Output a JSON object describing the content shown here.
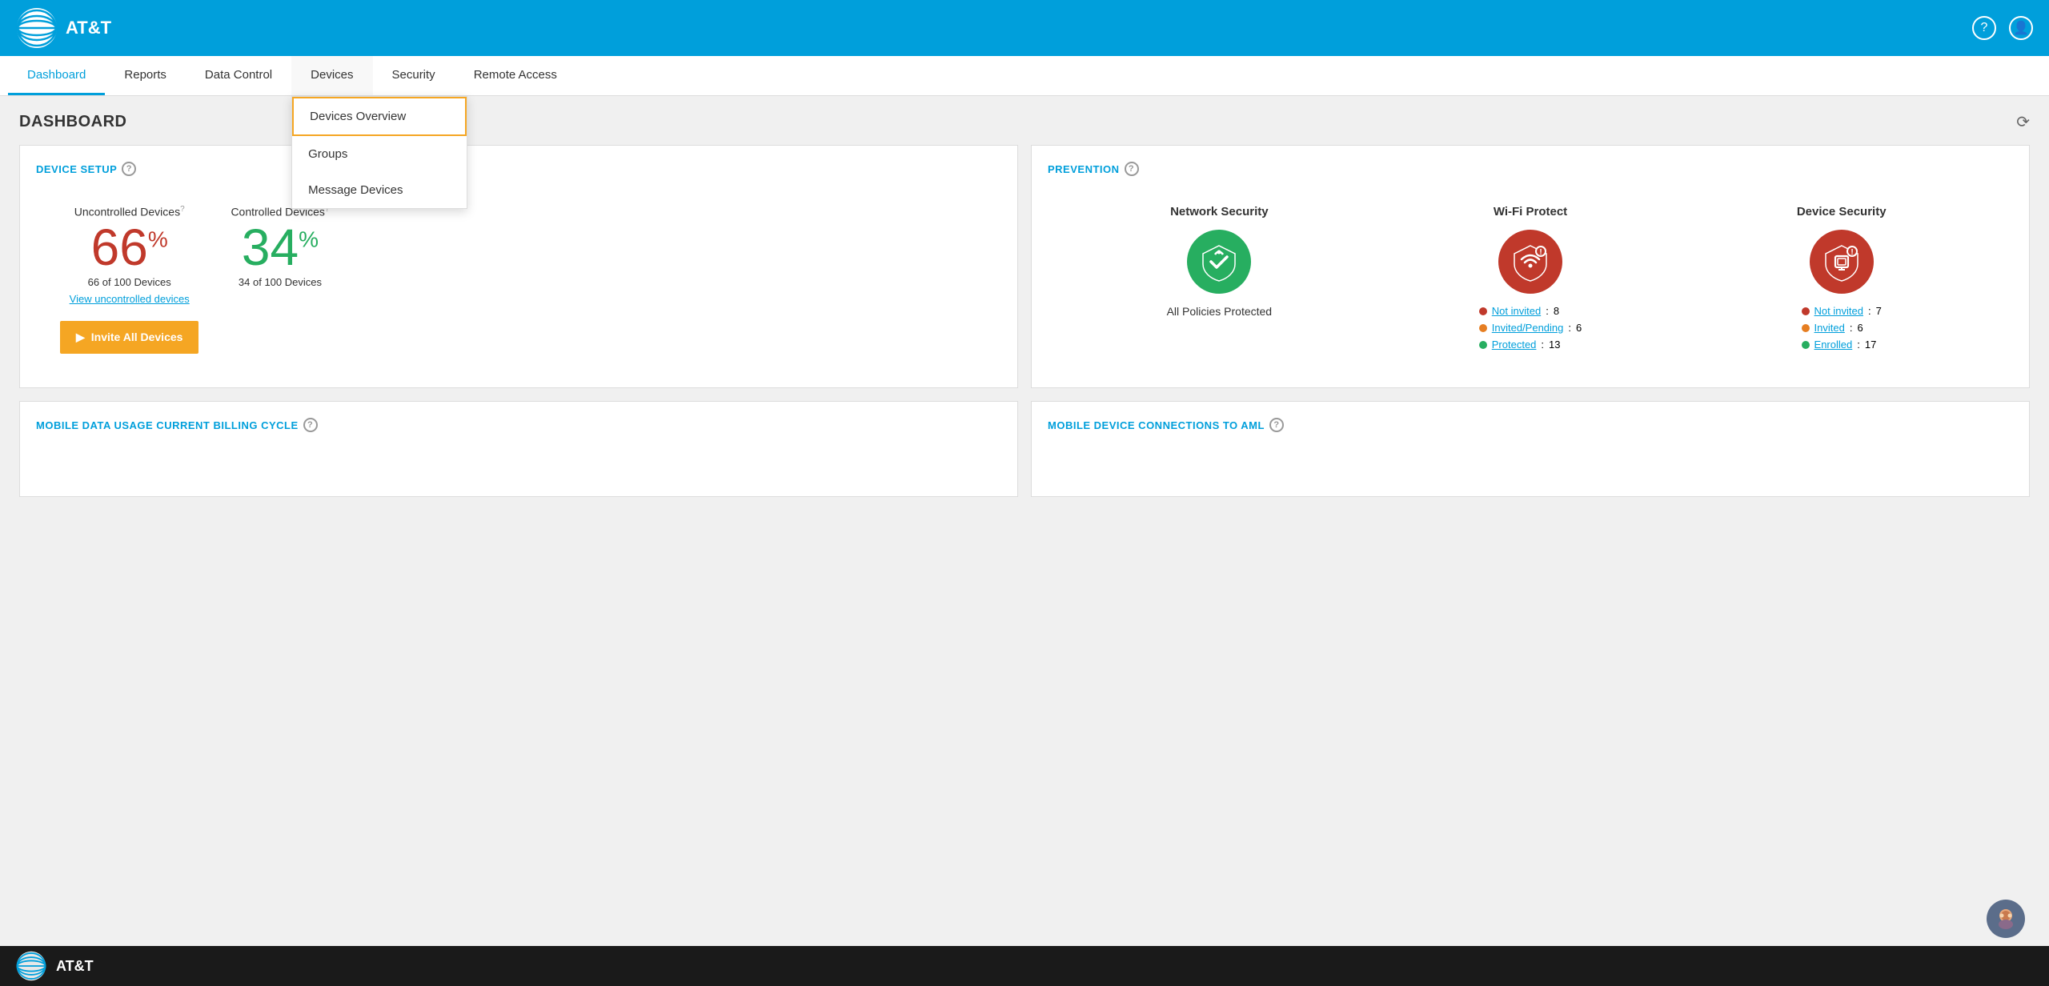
{
  "header": {
    "logo_text": "AT&T",
    "help_icon": "?",
    "user_icon": "👤"
  },
  "nav": {
    "items": [
      {
        "id": "dashboard",
        "label": "Dashboard",
        "active": true
      },
      {
        "id": "reports",
        "label": "Reports",
        "active": false
      },
      {
        "id": "data-control",
        "label": "Data Control",
        "active": false
      },
      {
        "id": "devices",
        "label": "Devices",
        "active": false
      },
      {
        "id": "security",
        "label": "Security",
        "active": false
      },
      {
        "id": "remote-access",
        "label": "Remote Access",
        "active": false
      }
    ],
    "devices_dropdown": {
      "items": [
        {
          "id": "devices-overview",
          "label": "Devices Overview",
          "highlighted": true
        },
        {
          "id": "groups",
          "label": "Groups"
        },
        {
          "id": "message-devices",
          "label": "Message Devices"
        }
      ]
    }
  },
  "dashboard": {
    "title": "DASHBOARD",
    "refresh_title": "Refresh"
  },
  "device_setup": {
    "title": "DEVICE SETUP",
    "help": "?",
    "uncontrolled_label": "Uncontrolled Devices",
    "uncontrolled_percent": "66",
    "uncontrolled_count": "66 of 100 Devices",
    "view_link": "View uncontrolled devices",
    "controlled_label": "Controlled Devices",
    "controlled_percent": "34",
    "controlled_count": "34 of 100 Devices",
    "invite_button": "Invite All Devices"
  },
  "prevention": {
    "title": "PREVENTION",
    "help": "?",
    "network_security": {
      "title": "Network Security",
      "status": "All Policies Protected"
    },
    "wifi_protect": {
      "title": "Wi-Fi Protect",
      "not_invited_label": "Not invited",
      "not_invited_count": "8",
      "invited_pending_label": "Invited/Pending",
      "invited_pending_count": "6",
      "protected_label": "Protected",
      "protected_count": "13"
    },
    "device_security": {
      "title": "Device Security",
      "not_invited_label": "Not invited",
      "not_invited_count": "7",
      "invited_label": "Invited",
      "invited_count": "6",
      "enrolled_label": "Enrolled",
      "enrolled_count": "17"
    }
  },
  "bottom_cards": {
    "mobile_data": {
      "title": "MOBILE DATA USAGE CURRENT BILLING CYCLE",
      "help": "?"
    },
    "mobile_connections": {
      "title": "MOBILE DEVICE CONNECTIONS TO AML",
      "help": "?"
    }
  },
  "footer": {
    "logo_text": "AT&T"
  }
}
